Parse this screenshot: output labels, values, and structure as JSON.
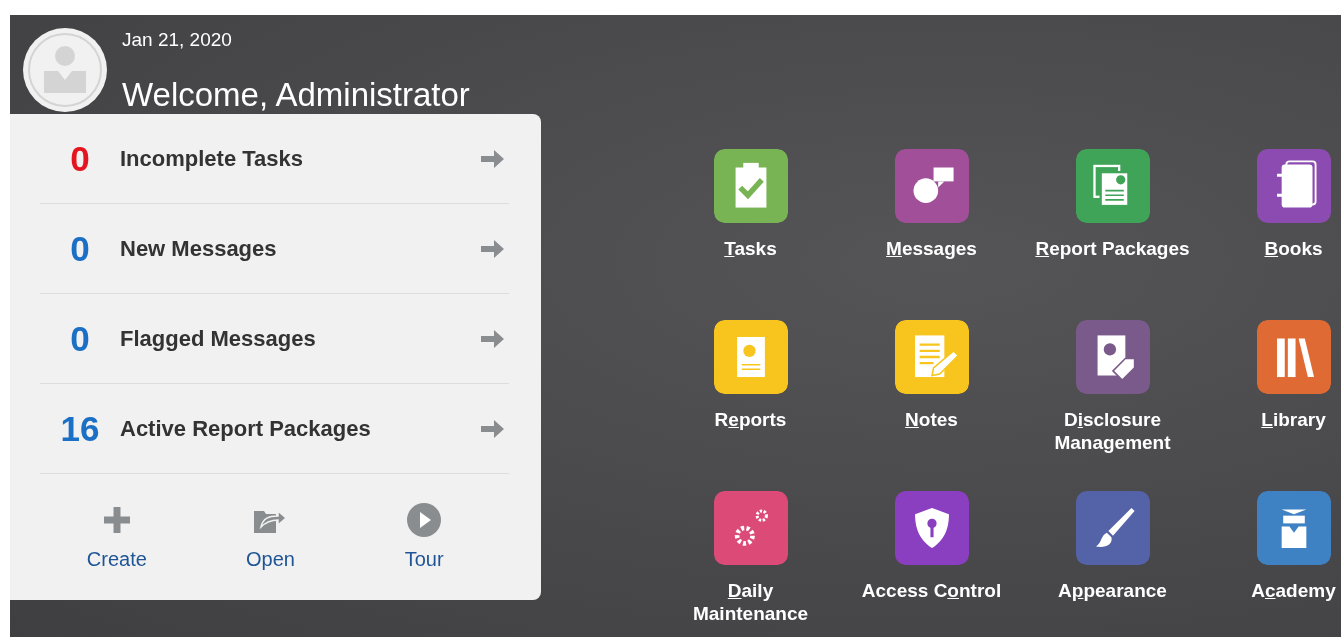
{
  "header": {
    "date": "Jan 21, 2020",
    "welcome": "Welcome, Administrator"
  },
  "summary": [
    {
      "count": "0",
      "color": "#e4151e",
      "label": "Incomplete Tasks"
    },
    {
      "count": "0",
      "color": "#1b6fc4",
      "label": "New Messages"
    },
    {
      "count": "0",
      "color": "#1b6fc4",
      "label": "Flagged Messages"
    },
    {
      "count": "16",
      "color": "#1b6fc4",
      "label": "Active Report Packages"
    }
  ],
  "actions": [
    {
      "kind": "create",
      "label": "Create"
    },
    {
      "kind": "open",
      "label": "Open"
    },
    {
      "kind": "tour",
      "label": "Tour"
    }
  ],
  "tiles": [
    {
      "kind": "tasks",
      "color": "#78b354",
      "hotkey": "T",
      "label_rest": "asks"
    },
    {
      "kind": "messages",
      "color": "#a04f98",
      "hotkey": "M",
      "label_rest": "essages"
    },
    {
      "kind": "packages",
      "color": "#3fa458",
      "hotkey": "R",
      "label_rest": "eport Packages"
    },
    {
      "kind": "books",
      "color": "#8c4bb0",
      "hotkey": "B",
      "label_rest": "ooks"
    },
    {
      "kind": "reports",
      "color": "#f7c51d",
      "label_start": "R",
      "hotkey": "e",
      "label_rest": "ports"
    },
    {
      "kind": "notes",
      "color": "#f7c51d",
      "hotkey": "N",
      "label_rest": "otes"
    },
    {
      "kind": "disclosure",
      "color": "#7a5a8a",
      "label_start": "D",
      "hotkey": "i",
      "label_rest": "sclosure Management"
    },
    {
      "kind": "library",
      "color": "#e06a33",
      "hotkey": "L",
      "label_rest": "ibrary"
    },
    {
      "kind": "maintenance",
      "color": "#dc4a78",
      "hotkey": "D",
      "label_rest": "aily Maintenance"
    },
    {
      "kind": "access",
      "color": "#8a3ec0",
      "label_start": "Access C",
      "hotkey": "o",
      "label_rest": "ntrol"
    },
    {
      "kind": "appearance",
      "color": "#5462a8",
      "label_start": "A",
      "hotkey": "p",
      "label_rest": "pearance"
    },
    {
      "kind": "academy",
      "color": "#3f82c4",
      "label_start": "A",
      "hotkey": "c",
      "label_rest": "ademy"
    }
  ]
}
